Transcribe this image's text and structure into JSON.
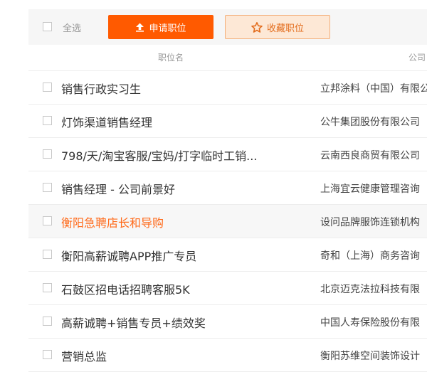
{
  "toolbar": {
    "select_all_label": "全选",
    "apply_label": "申请职位",
    "favorite_label": "收藏职位"
  },
  "table": {
    "headers": [
      "职位名",
      "公司"
    ],
    "rows": [
      {
        "position": "销售行政实习生",
        "company": "立邦涂料（中国）有限公司"
      },
      {
        "position": "灯饰渠道销售经理",
        "company": "公牛集团股份有限公司"
      },
      {
        "position": "798/天/淘宝客服/宝妈/打字临时工销...",
        "company": "云南西良商贸有限公司"
      },
      {
        "position": "销售经理 - 公司前景好",
        "company": "上海宜云健康管理咨询"
      },
      {
        "position": "衡阳急聘店长和导购",
        "company": "设问品牌服饰连锁机构"
      },
      {
        "position": "衡阳高薪诚聘APP推广专员",
        "company": "奇和（上海）商务咨询"
      },
      {
        "position": "石鼓区招电话招聘客服5K",
        "company": "北京迈克法拉科技有限"
      },
      {
        "position": "高薪诚聘+销售专员+绩效奖",
        "company": "中国人寿保险股份有限"
      },
      {
        "position": "营销总监",
        "company": "衡阳苏维空间装饰设计"
      }
    ]
  },
  "colors": {
    "accent": "#ff5a00",
    "accent_text": "#ff6a1a",
    "favorite_bg": "#fde8d6",
    "favorite_border": "#f3b07b"
  },
  "icons": {
    "apply": "upload-arrow-icon",
    "favorite": "star-icon"
  }
}
